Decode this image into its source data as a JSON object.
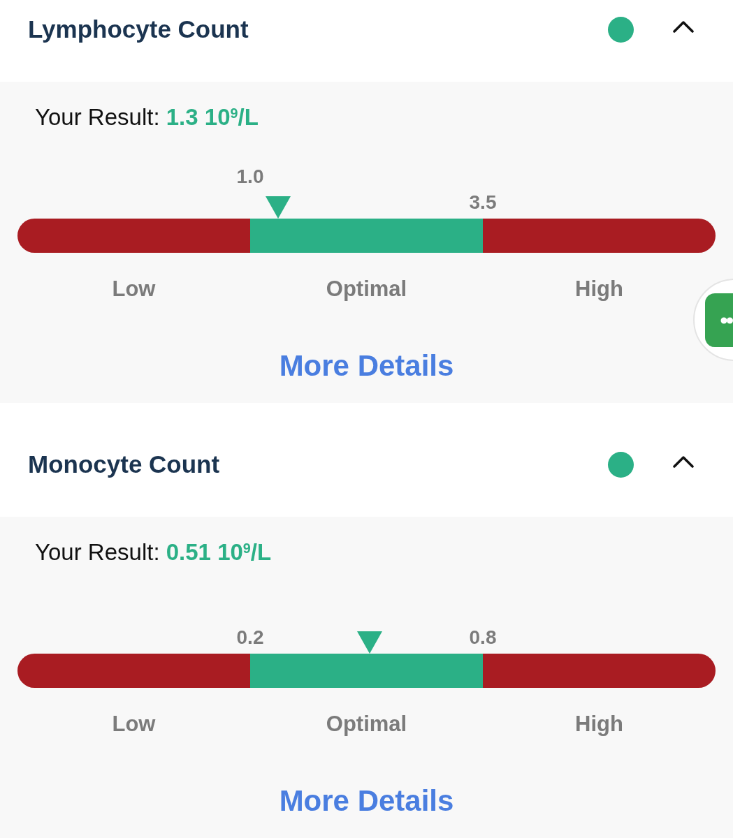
{
  "sections": [
    {
      "title": "Lymphocyte Count",
      "color": "#2bb086",
      "expanded": true,
      "result_label": "Your Result:",
      "result_value": "1.3 10$^{9}$/L",
      "thresholds": [
        "1.0",
        "3.5"
      ],
      "ranges": [
        {
          "label": "Low",
          "color": "#a91c22"
        },
        {
          "label": "Optimal",
          "color": "#2bb086"
        },
        {
          "label": "High",
          "color": "#a91c22"
        }
      ],
      "marker": {
        "level": 0.373
      },
      "link": "More Details"
    },
    {
      "title": "Monocyte Count",
      "color": "#2bb086",
      "expanded": true,
      "result_label": "Your Result:",
      "result_value": "0.51 10$^{9}$/L",
      "thresholds": [
        "0.2",
        "0.8"
      ],
      "ranges": [
        {
          "label": "Low",
          "color": "#a91c22"
        },
        {
          "label": "Optimal",
          "color": "#2bb086"
        },
        {
          "label": "High",
          "color": "#a91c22"
        }
      ],
      "marker": {
        "level": 0.505
      },
      "link": "More Details"
    }
  ]
}
